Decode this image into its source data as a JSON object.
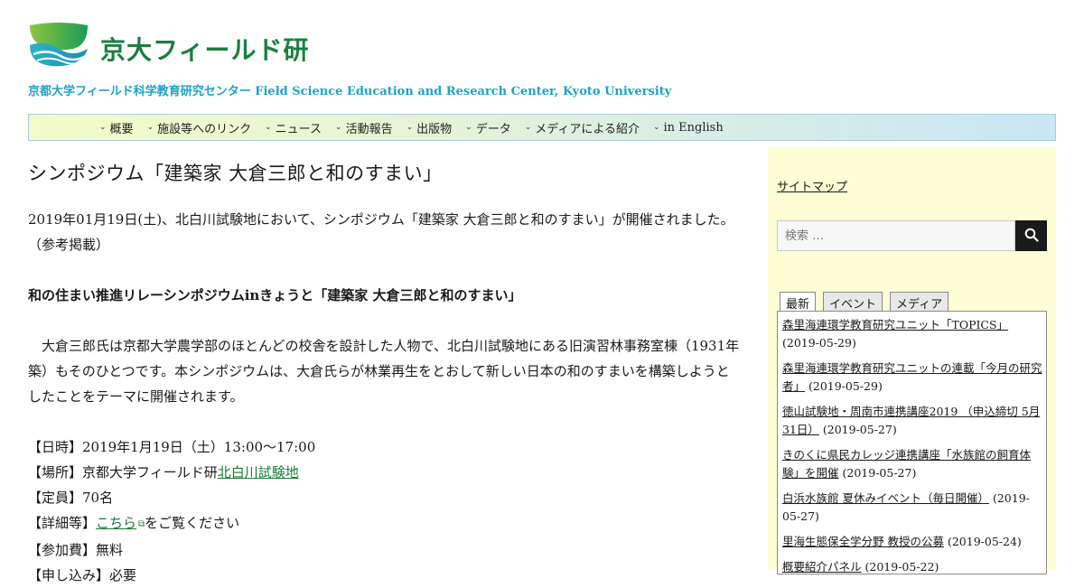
{
  "header": {
    "site_title": "京大フィールド研",
    "site_description": "京都大学フィールド科学教育研究センター Field Science Education and Research Center, Kyoto University",
    "logo_icon": "wave-leaf-logo"
  },
  "nav": {
    "items": [
      "概要",
      "施設等へのリンク",
      "ニュース",
      "活動報告",
      "出版物",
      "データ",
      "メディアによる紹介",
      "in English"
    ]
  },
  "post": {
    "title": "シンポジウム「建築家 大倉三郎と和のすまい」",
    "intro": "2019年01月19日(土)、北白川試験地において、シンポジウム「建築家 大倉三郎と和のすまい」が開催されました。（参考掲載）",
    "subtitle": "和の住まい推進リレーシンポジウムinきょうと「建築家 大倉三郎と和のすまい」",
    "body": "　大倉三郎氏は京都大学農学部のほとんどの校舎を設計した人物で、北白川試験地にある旧演習林事務室棟（1931年築）もそのひとつです。本シンポジウムは、大倉氏らが林業再生をとおして新しい日本の和のすまいを構築しようとしたことをテーマに開催されます。",
    "info": {
      "datetime": "【日時】2019年1月19日（土）13:00～17:00",
      "place_prefix": "【場所】京都大学フィールド研",
      "place_link": "北白川試験地",
      "capacity": "【定員】70名",
      "details_prefix": "【詳細等】",
      "details_link": "こちら",
      "details_suffix": "をご覧ください",
      "fee": "【参加費】無料",
      "partial": "【申し込み】必要"
    }
  },
  "sidebar": {
    "sitemap_label": "サイトマップ",
    "search_placeholder": "検索 …",
    "tabs": [
      "最新",
      "イベント",
      "メディア"
    ],
    "news": [
      {
        "title": "森里海連環学教育研究ユニット「TOPICS」",
        "date": "(2019-05-29)"
      },
      {
        "title": "森里海連環学教育研究ユニットの連載「今月の研究者」",
        "date": "(2019-05-29)"
      },
      {
        "title": "徳山試験地・周南市連携講座2019 （申込締切 5月31日）",
        "date": "(2019-05-27)"
      },
      {
        "title": "きのくに県民カレッジ連携講座「水族館の飼育体験」を開催",
        "date": "(2019-05-27)"
      },
      {
        "title": "白浜水族館 夏休みイベント（毎日開催）",
        "date": "(2019-05-27)"
      },
      {
        "title": "里海生態保全学分野 教授の公募",
        "date": "(2019-05-24)"
      },
      {
        "title": "概要紹介パネル",
        "date": "(2019-05-22)"
      }
    ]
  }
}
